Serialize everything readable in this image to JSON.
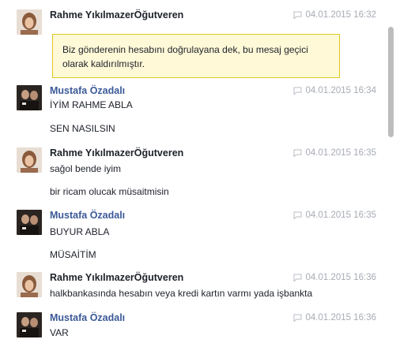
{
  "messages": [
    {
      "sender": "Rahme YıkılmazerÖğutveren",
      "time": "04.01.2015 16:32",
      "notice": "Biz gönderenin hesabını doğrulayana dek, bu mesaj geçici olarak kaldırılmıştır."
    },
    {
      "sender": "Mustafa Özadalı",
      "time": "04.01.2015 16:34",
      "lines": [
        "İYİM RAHME ABLA",
        "SEN NASILSIN"
      ]
    },
    {
      "sender": "Rahme YıkılmazerÖğutveren",
      "time": "04.01.2015 16:35",
      "lines": [
        "sağol bende iyim",
        "bir ricam olucak müsaitmisin"
      ]
    },
    {
      "sender": "Mustafa Özadalı",
      "time": "04.01.2015 16:35",
      "lines": [
        "BUYUR ABLA",
        "MÜSAİTİM"
      ]
    },
    {
      "sender": "Rahme YıkılmazerÖğutveren",
      "time": "04.01.2015 16:36",
      "lines": [
        "halkbankasında hesabın veya kredi kartın varmı yada işbankta"
      ]
    },
    {
      "sender": "Mustafa Özadalı",
      "time": "04.01.2015 16:36",
      "lines": [
        "VAR"
      ]
    }
  ],
  "colors": {
    "sender_dark": "#1d2129",
    "sender_blue": "#3b5998",
    "timestamp": "#a6abb4",
    "notice_bg": "#fff9d7",
    "notice_border": "#e2c822"
  }
}
